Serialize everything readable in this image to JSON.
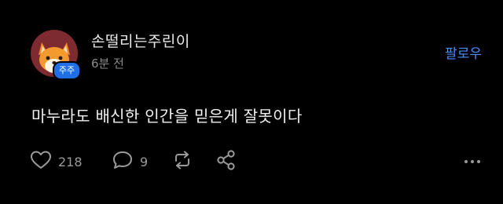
{
  "post": {
    "author": {
      "username": "손떨리는주린이",
      "badge": "주주"
    },
    "timestamp": "6분 전",
    "follow_label": "팔로우",
    "content": "마누라도 배신한 인간을 믿은게 잘못이다",
    "stats": {
      "likes": "218",
      "comments": "9"
    }
  },
  "colors": {
    "background": "#000000",
    "accent": "#4c8df6",
    "badge": "#1f6fe6",
    "muted": "#8a8a8a"
  },
  "icons": {
    "avatar": "fox-avatar-icon",
    "like": "heart-icon",
    "comment": "comment-bubble-icon",
    "repost": "repost-icon",
    "share": "share-icon",
    "more": "more-options-icon"
  }
}
